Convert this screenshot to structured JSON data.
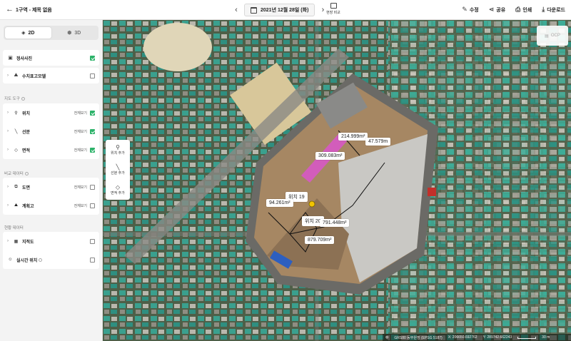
{
  "header": {
    "back_icon": "arrow-left",
    "title": "1구역 - 제목 없음",
    "date": "2021년 12월 28일 (화)",
    "compare_label": "현장 비교",
    "actions": [
      {
        "icon": "pencil-icon",
        "label": "수정"
      },
      {
        "icon": "share-icon",
        "label": "공유"
      },
      {
        "icon": "print-icon",
        "label": "인쇄"
      },
      {
        "icon": "download-icon",
        "label": "다운로드"
      }
    ]
  },
  "view_toggle": {
    "options": [
      "2D",
      "3D"
    ],
    "selected": "2D"
  },
  "layers": {
    "ortho": {
      "label": "정사사진",
      "checked": true
    },
    "elevation": {
      "label": "수치표고모델",
      "checked": false
    }
  },
  "sections": {
    "map_tools": "지도 도구",
    "compare_data": "비교 데이터",
    "site_data": "현황 데이터"
  },
  "map_tools": [
    {
      "label": "위치",
      "all": "전체보기",
      "checked": true
    },
    {
      "label": "선분",
      "all": "전체보기",
      "checked": true
    },
    {
      "label": "면적",
      "all": "전체보기",
      "checked": true
    }
  ],
  "compare_items": [
    {
      "label": "도면",
      "all": "전체보기",
      "checked": false
    },
    {
      "label": "계획고",
      "all": "전체보기",
      "checked": false
    }
  ],
  "site_items": [
    {
      "label": "지적도",
      "checked": false
    },
    {
      "label": "실시간 위치",
      "checked": false
    }
  ],
  "tool_panel": [
    "위치 추가",
    "선분 추가",
    "면적 추가"
  ],
  "ocp_label": "OCP",
  "annotations": {
    "a1": "214.999m²",
    "a2": "47.579m",
    "a3": "309.083m²",
    "a4": "위치 19",
    "a5": "94.261m²",
    "a6": "위치 20",
    "a7": "791.448m²",
    "a8": "879.709m²"
  },
  "footer": {
    "crs": "GRS80 동부원점 (EPSG 5187)",
    "x": "X: 206650.692762",
    "y": "Y: 289742.662243",
    "scale": "30 m"
  },
  "colors": {
    "accent": "#2db36a",
    "polygon": "#e04fd8",
    "pin": "#f2c400"
  }
}
